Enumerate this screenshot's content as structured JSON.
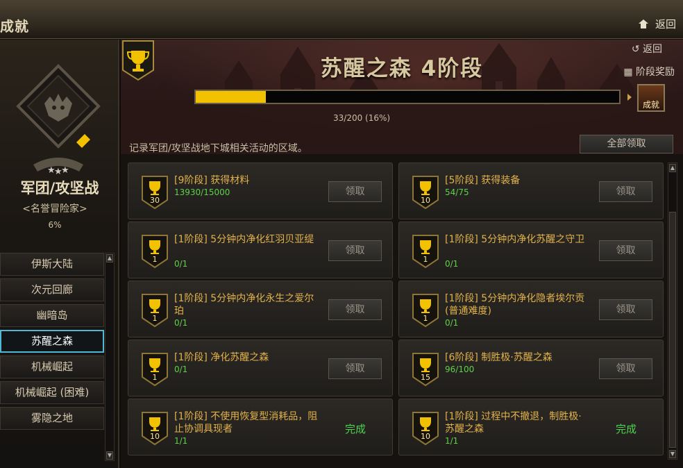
{
  "window": {
    "title": "成就",
    "home_label": "返回"
  },
  "category": {
    "title": "军团/攻坚战",
    "subtitle": "<名誉冒险家>",
    "percent": "6%"
  },
  "menu": [
    {
      "label": "伊斯大陆"
    },
    {
      "label": "次元回廊"
    },
    {
      "label": "幽暗岛"
    },
    {
      "label": "苏醒之森",
      "active": true
    },
    {
      "label": "机械崛起"
    },
    {
      "label": "机械崛起 (困难)"
    },
    {
      "label": "雾隐之地"
    }
  ],
  "stage": {
    "title": "苏醒之森 4阶段",
    "back_label": "返回",
    "reward_label": "阶段奖励",
    "progress_text": "33/200 (16%)",
    "progress_fraction": 0.165,
    "badge_label": "成就",
    "description": "记录军团/攻坚战地下城相关活动的区域。",
    "claim_all_label": "全部领取"
  },
  "achievements": [
    {
      "points": "30",
      "title": "[9阶段] 获得材料",
      "progress": "13930/15000",
      "action": "领取",
      "done": false
    },
    {
      "points": "10",
      "title": "[5阶段] 获得装备",
      "progress": "54/75",
      "action": "领取",
      "done": false
    },
    {
      "points": "1",
      "title": "[1阶段] 5分钟内净化红羽贝亚缇",
      "progress": "0/1",
      "action": "领取",
      "done": false
    },
    {
      "points": "1",
      "title": "[1阶段] 5分钟内净化苏醒之守卫",
      "progress": "0/1",
      "action": "领取",
      "done": false
    },
    {
      "points": "1",
      "title": "[1阶段] 5分钟内净化永生之爱尔珀",
      "progress": "0/1",
      "action": "领取",
      "done": false
    },
    {
      "points": "1",
      "title": "[1阶段] 5分钟内净化隐者埃尔贡 (普通难度)",
      "progress": "0/1",
      "action": "领取",
      "done": false
    },
    {
      "points": "1",
      "title": "[1阶段] 净化苏醒之森",
      "progress": "0/1",
      "action": "领取",
      "done": false
    },
    {
      "points": "15",
      "title": "[6阶段] 制胜极·苏醒之森",
      "progress": "96/100",
      "action": "领取",
      "done": false
    },
    {
      "points": "10",
      "title": "[1阶段] 不使用恢复型消耗品，阻止协调具现者",
      "progress": "1/1",
      "action": "完成",
      "done": true
    },
    {
      "points": "10",
      "title": "[1阶段] 过程中不撤退，制胜极·苏醒之森",
      "progress": "1/1",
      "action": "完成",
      "done": true
    }
  ],
  "colors": {
    "accent_gold": "#f2c200",
    "title_gold": "#e2b24a",
    "progress_green": "#5fd14a",
    "done_green": "#4fd24f",
    "active_border": "#4fb8d6"
  }
}
